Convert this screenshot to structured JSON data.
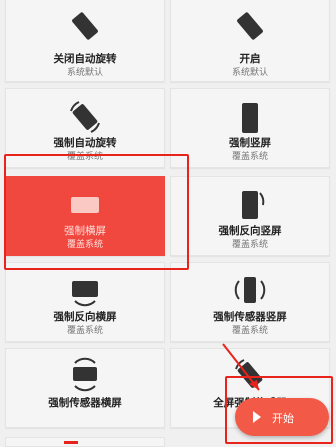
{
  "tiles": [
    {
      "title": "关闭自动旋转",
      "subtitle": "系统默认",
      "icon": "rotation-lock-icon"
    },
    {
      "title": "开启",
      "subtitle": "系统默认",
      "icon": "rotation-on-icon"
    },
    {
      "title": "强制自动旋转",
      "subtitle": "覆盖系统",
      "icon": "auto-rotate-icon"
    },
    {
      "title": "强制竖屏",
      "subtitle": "覆盖系统",
      "icon": "portrait-icon"
    },
    {
      "title": "强制横屏",
      "subtitle": "覆盖系统",
      "icon": "landscape-icon"
    },
    {
      "title": "强制反向竖屏",
      "subtitle": "覆盖系统",
      "icon": "reverse-portrait-icon"
    },
    {
      "title": "强制反向横屏",
      "subtitle": "覆盖系统",
      "icon": "reverse-landscape-icon"
    },
    {
      "title": "强制传感器竖屏",
      "subtitle": "覆盖系统",
      "icon": "sensor-portrait-icon"
    },
    {
      "title": "强制传感器横屏",
      "subtitle": "",
      "icon": "sensor-landscape-icon"
    },
    {
      "title": "全屏强制传感器",
      "subtitle": "",
      "icon": "full-sensor-icon"
    }
  ],
  "fab": {
    "label": "开始"
  },
  "colors": {
    "accent": "#f0483e",
    "highlight": "#e8231c"
  }
}
